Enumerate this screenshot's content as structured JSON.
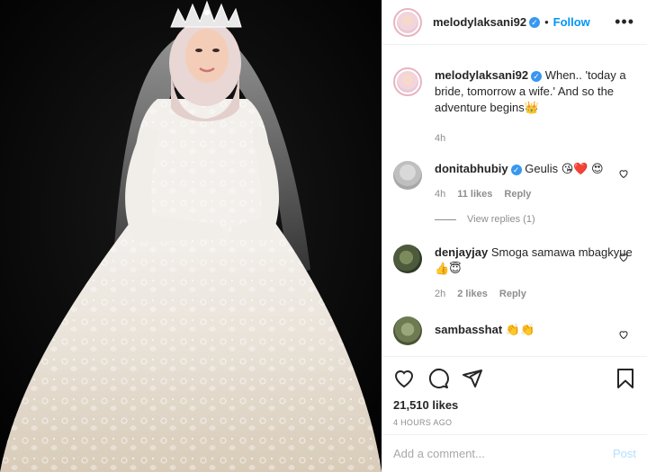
{
  "header": {
    "username": "melodylaksani92",
    "verified_icon": "verified-badge-icon",
    "separator": "•",
    "follow_label": "Follow",
    "more_icon": "more-options-icon"
  },
  "caption": {
    "username": "melodylaksani92",
    "text": "When.. 'today a bride, tomorrow a wife.' And so the adventure begins👑",
    "time": "4h"
  },
  "comments": [
    {
      "username": "donitabhubiy",
      "verified": true,
      "text": "Geulis 😘❤️ 😍",
      "time": "4h",
      "likes": "11 likes",
      "reply_label": "Reply",
      "view_replies": "View replies (1)"
    },
    {
      "username": "denjayjay",
      "verified": false,
      "text": "Smoga samawa mbagkyue👍😇",
      "time": "2h",
      "likes": "2 likes",
      "reply_label": "Reply"
    },
    {
      "username": "sambasshat",
      "verified": false,
      "text": "👏👏"
    }
  ],
  "actions": {
    "like_icon": "heart-icon",
    "comment_icon": "comment-icon",
    "share_icon": "share-icon",
    "save_icon": "bookmark-icon",
    "likes_count": "21,510 likes",
    "timestamp": "4 HOURS AGO"
  },
  "add_comment": {
    "placeholder": "Add a comment...",
    "post_label": "Post"
  },
  "colors": {
    "accent": "#0095f6",
    "verified": "#3897f0",
    "muted": "#8e8e8e",
    "post_disabled": "#b2dffc"
  }
}
